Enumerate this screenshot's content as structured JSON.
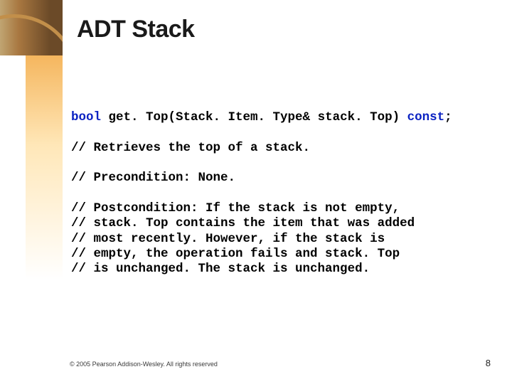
{
  "slide": {
    "title": "ADT Stack",
    "code_sig_prefix": "bool",
    "code_sig_mid": " get. Top(Stack. Item. Type& stack. Top) ",
    "code_sig_suffix": "const",
    "code_sig_end": ";",
    "code_c1": "// Retrieves the top of a stack.",
    "code_c2": "// Precondition: None.",
    "code_c3": "// Postcondition: If the stack is not empty,",
    "code_c4": "// stack. Top contains the item that was added",
    "code_c5": "// most recently. However, if the stack is",
    "code_c6": "// empty, the operation fails and stack. Top",
    "code_c7": "// is unchanged. The stack is unchanged."
  },
  "footer": {
    "copyright": "© 2005 Pearson Addison-Wesley. All rights reserved",
    "page": "8"
  }
}
